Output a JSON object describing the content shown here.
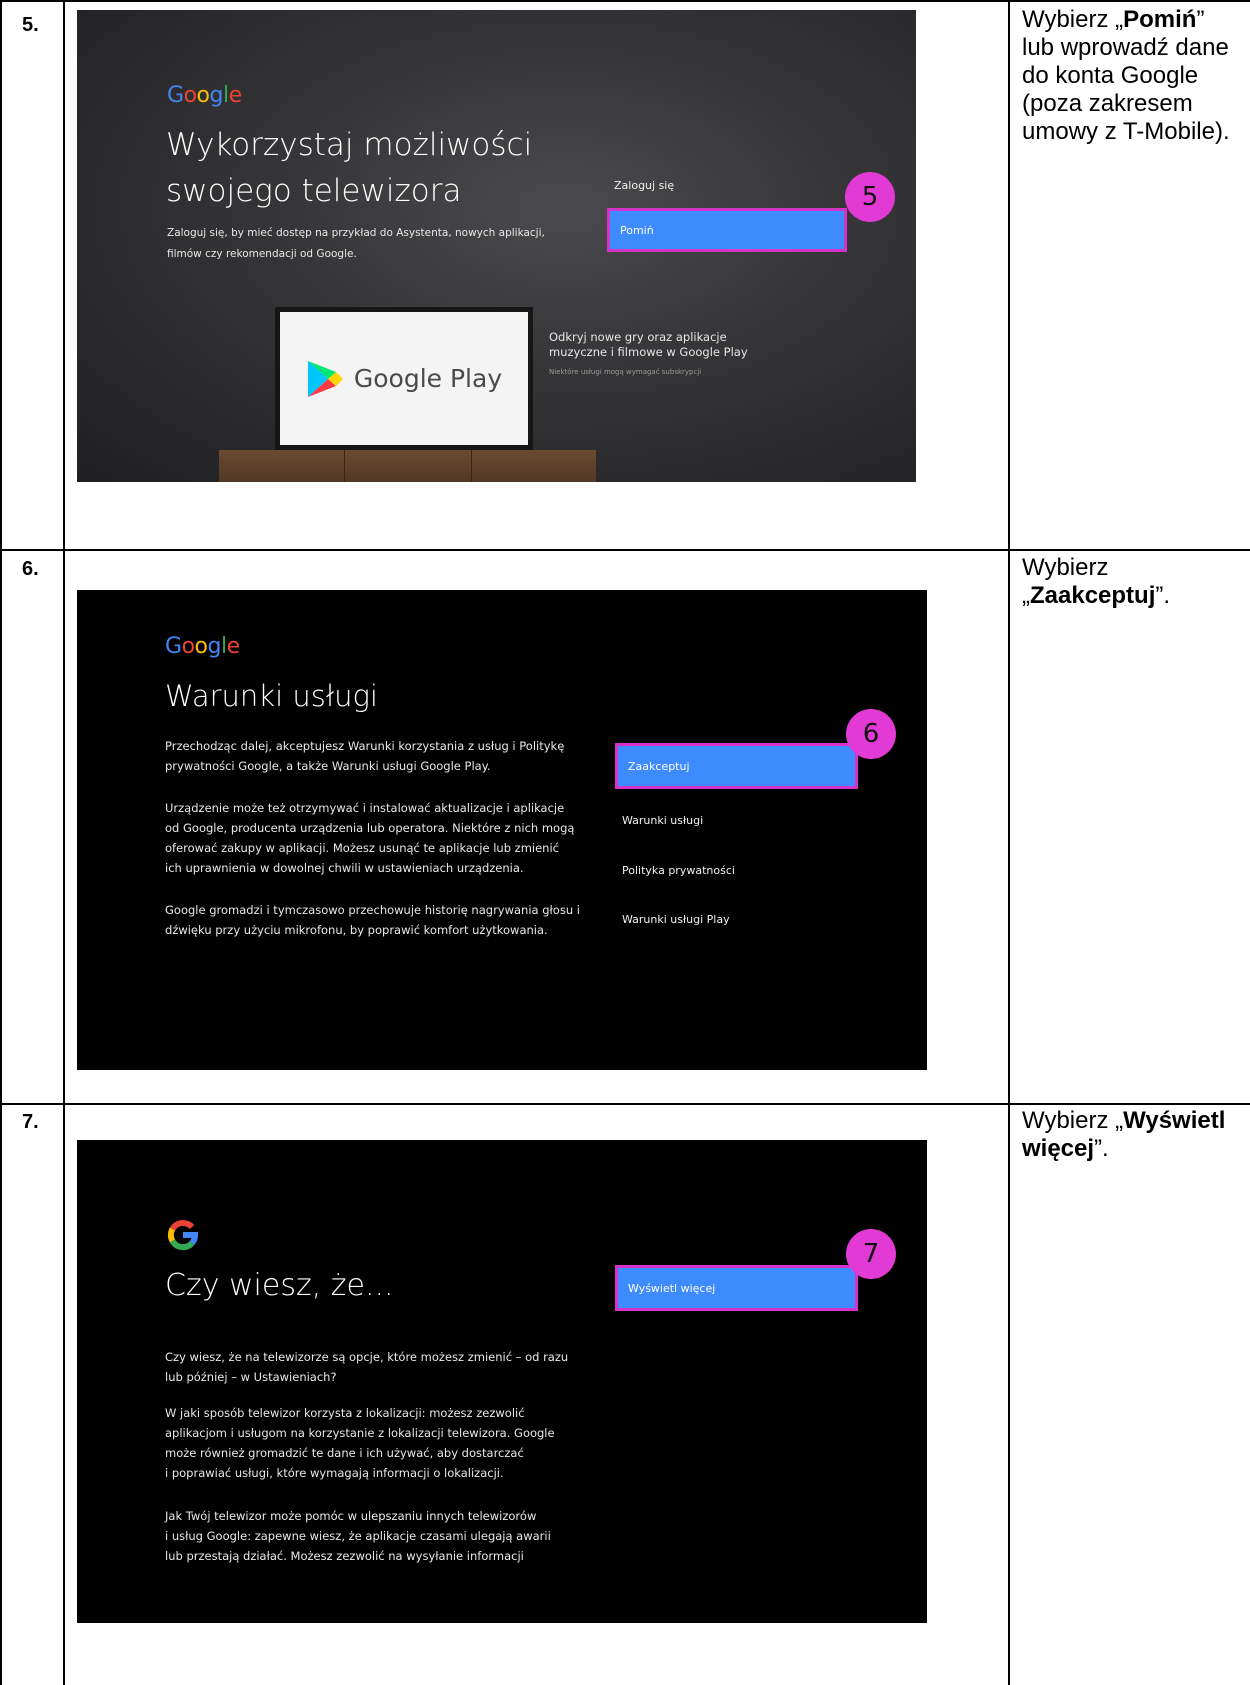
{
  "rows": [
    {
      "step": "5.",
      "instruction_before": "Wybierz „",
      "instruction_bold": "Pomiń",
      "instruction_after": "” lub wprowadź dane do konta Google (poza zakresem umowy z T-Mobile).",
      "screen": {
        "logo_parts": [
          "G",
          "o",
          "o",
          "g",
          "l",
          "e"
        ],
        "title_line1": "Wykorzystaj możliwości",
        "title_line2": "swojego telewizora",
        "desc_line1": "Zaloguj się, by mieć dostęp na przykład do Asystenta, nowych aplikacji,",
        "desc_line2": "filmów czy rekomendacji od Google.",
        "menu_item": "Zaloguj się",
        "selected_button": "Pomiń",
        "badge": "5",
        "tv_text": "Google Play",
        "promo_line1": "Odkryj nowe gry oraz aplikacje",
        "promo_line2": "muzyczne i filmowe w Google Play",
        "promo_small": "Niektóre usługi mogą wymagać subskrypcji"
      }
    },
    {
      "step": "6.",
      "instruction_before": "Wybierz „",
      "instruction_bold": "Zaakceptuj",
      "instruction_after": "”.",
      "screen": {
        "title": "Warunki usługi",
        "p1_l1": "Przechodząc dalej, akceptujesz Warunki korzystania z usług i Politykę",
        "p1_l2": "prywatności Google, a także Warunki usługi Google Play.",
        "p2_l1": "Urządzenie może też otrzymywać i instalować aktualizacje i aplikacje",
        "p2_l2": "od Google, producenta urządzenia lub operatora. Niektóre z nich mogą",
        "p2_l3": "oferować zakupy w aplikacji. Możesz usunąć te aplikacje lub zmienić",
        "p2_l4": "ich uprawnienia w dowolnej chwili w ustawieniach urządzenia.",
        "p3_l1": "Google gromadzi i tymczasowo przechowuje historię nagrywania głosu i",
        "p3_l2": "dźwięku przy użyciu mikrofonu, by poprawić komfort użytkowania.",
        "selected_button": "Zaakceptuj",
        "menu_items": [
          "Warunki usługi",
          "Polityka prywatności",
          "Warunki usługi Play"
        ],
        "badge": "6"
      }
    },
    {
      "step": "7.",
      "instruction_before": "Wybierz „",
      "instruction_bold": "Wyświetl więcej",
      "instruction_after": "”.",
      "screen": {
        "title": "Czy wiesz, że...",
        "p1_l1": "Czy wiesz, że na telewizorze są opcje, które możesz zmienić – od razu",
        "p1_l2": "lub później – w Ustawieniach?",
        "p2_l1": "W jaki sposób telewizor korzysta z lokalizacji: możesz zezwolić",
        "p2_l2": "aplikacjom i usługom na korzystanie z lokalizacji telewizora. Google",
        "p2_l3": "może również gromadzić te dane i ich używać, aby dostarczać",
        "p2_l4": "i poprawiać usługi, które wymagają informacji o lokalizacji.",
        "p3_l1": "Jak Twój telewizor może pomóc w ulepszaniu innych telewizorów",
        "p3_l2": "i usług Google: zapewne wiesz, że aplikacje czasami ulegają awarii",
        "p3_l3": "lub przestają działać. Możesz zezwolić na wysyłanie informacji",
        "selected_button": "Wyświetl więcej",
        "badge": "7"
      }
    }
  ],
  "colors": {
    "button_blue": "#3d8bff",
    "highlight_magenta": "#d633c9",
    "badge_magenta": "#e23ad5",
    "google_blue": "#4285F4",
    "google_red": "#EA4335",
    "google_yellow": "#FBBC05",
    "google_green": "#34A853"
  }
}
